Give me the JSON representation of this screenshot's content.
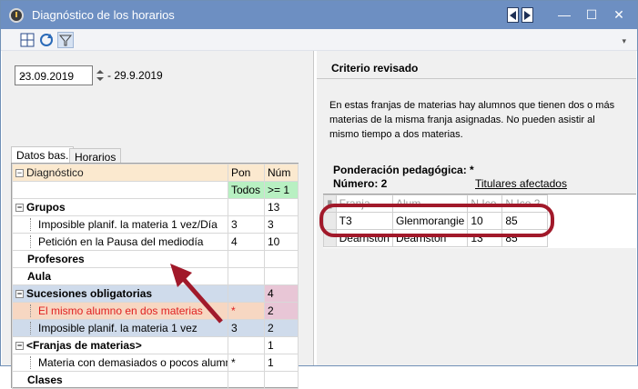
{
  "window": {
    "title": "Diagnóstico de los horarios",
    "app_icon": "clock-icon",
    "controls": [
      "minimize-icon",
      "maximize-icon",
      "close-icon"
    ]
  },
  "toolbar": {
    "icons": [
      "grid-icon",
      "refresh-icon",
      "filter-icon"
    ]
  },
  "date_range": {
    "start": "23.09.2019",
    "end": "- 29.9.2019"
  },
  "tabs": [
    {
      "label": "Datos bas.",
      "active": true
    },
    {
      "label": "Horarios",
      "active": false
    }
  ],
  "grid": {
    "headers": {
      "c1": "Diagnóstico",
      "c2": "Pon",
      "c3": "Núm"
    },
    "filter_row": {
      "c2": "Todos",
      "c3": ">= 1"
    },
    "rows": [
      {
        "label": "Grupos",
        "pon": "",
        "num": "13"
      },
      {
        "label": "Imposible planif. la materia 1 vez/Día",
        "pon": "3",
        "num": "3"
      },
      {
        "label": "Petición en la Pausa del mediodía",
        "pon": "4",
        "num": "10"
      },
      {
        "label": "Profesores",
        "pon": "",
        "num": ""
      },
      {
        "label": "Aula",
        "pon": "",
        "num": ""
      },
      {
        "label": "Sucesiones obligatorias",
        "pon": "",
        "num": "4"
      },
      {
        "label": "El mismo alumno en dos materias",
        "pon": "*",
        "num": "2"
      },
      {
        "label": "Imposible planif. la materia 1 vez",
        "pon": "3",
        "num": "2"
      },
      {
        "label": "<Franjas de materias>",
        "pon": "",
        "num": "1"
      },
      {
        "label": "Materia con demasiados o pocos alumnos",
        "pon": "*",
        "num": "1"
      },
      {
        "label": "Clases",
        "pon": "",
        "num": ""
      }
    ]
  },
  "right": {
    "title": "Criterio revisado",
    "description": "En estas franjas de materias hay alumnos que tienen dos o más materias de la misma franja asignadas. No pueden asistir al mismo tiempo a dos materias.",
    "ponderacion": "Ponderación pedagógica: *",
    "numero": "Número: 2",
    "link": "Titulares afectados",
    "table": {
      "headers": [
        "Franja",
        "Alum",
        "N.Ico",
        "N.Ico 2"
      ],
      "rows": [
        [
          "T3",
          "Glenmorangie",
          "10",
          "85"
        ],
        [
          "Dearnston",
          "Dearnston",
          "13",
          "85"
        ]
      ]
    }
  },
  "colors": {
    "titlebar": "#6d8fc2",
    "callout": "#a1192a",
    "header_bg": "#fbe9cf",
    "filter_bg": "#b8f0c2",
    "highlight_bg": "#f7d7c2",
    "error_text": "#e02020"
  }
}
